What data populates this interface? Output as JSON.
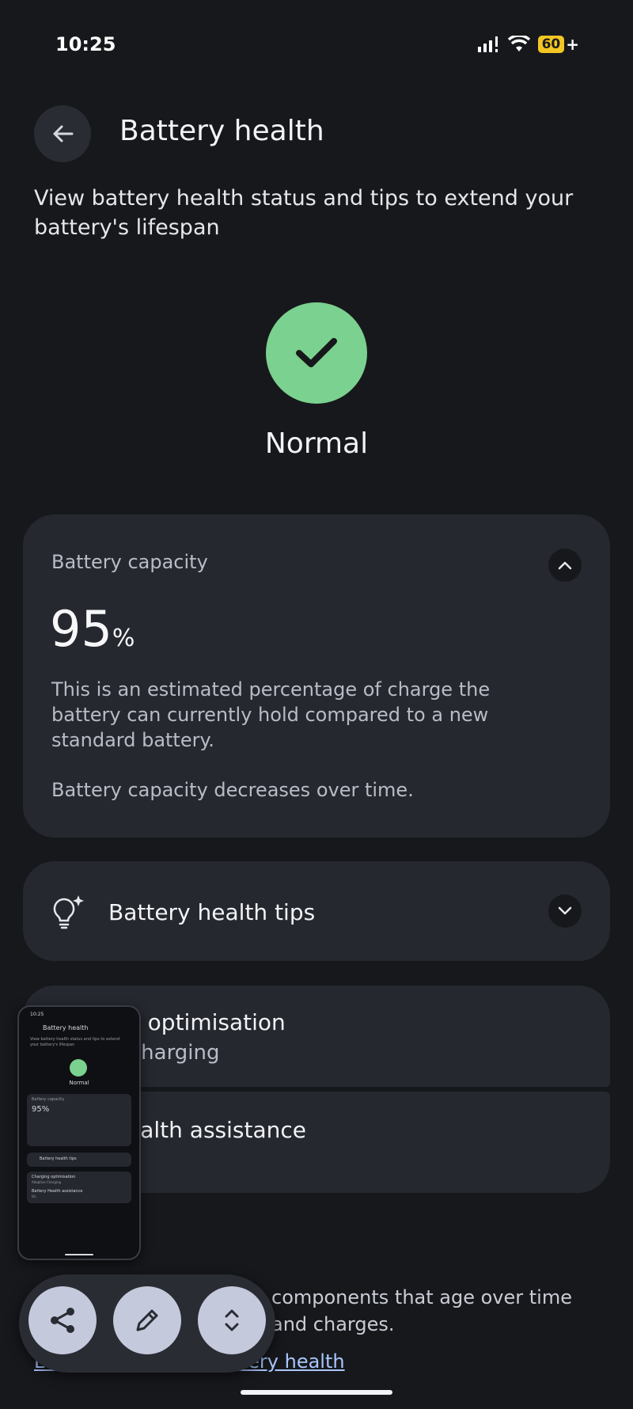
{
  "status_bar": {
    "time": "10:25",
    "battery_level": "60",
    "battery_plus": "+"
  },
  "header": {
    "title": "Battery health",
    "subtitle": "View battery health status and tips to extend your battery's lifespan"
  },
  "status": {
    "label": "Normal",
    "color": "#7bd18f"
  },
  "capacity": {
    "title": "Battery capacity",
    "value": "95",
    "unit": "%",
    "description": "This is an estimated percentage of charge the battery can currently hold compared to a new standard battery.",
    "note": "Battery capacity decreases over time."
  },
  "tips": {
    "label": "Battery health tips"
  },
  "settings": [
    {
      "label": "g optimisation",
      "value": "Charging"
    },
    {
      "label": "ealth assistance"
    }
  ],
  "footer": {
    "text": "components that age over time and charges.",
    "link": "Learn more about battery health"
  },
  "thumbnail": {
    "time": "10:25",
    "title": "Battery health",
    "subtitle": "View battery health status and tips to extend your battery's lifespan",
    "status": "Normal",
    "capacity_title": "Battery capacity",
    "capacity_value": "95%",
    "tips": "Battery health tips",
    "opt_label": "Charging optimisation",
    "opt_value": "Adaptive Charging",
    "assist_label": "Battery Health assistance",
    "assist_value": "On"
  },
  "colors": {
    "background": "#17181c",
    "card": "#262830",
    "accent_green": "#7bd18f",
    "link": "#a9c7ff",
    "fab": "#c4c9dc"
  }
}
